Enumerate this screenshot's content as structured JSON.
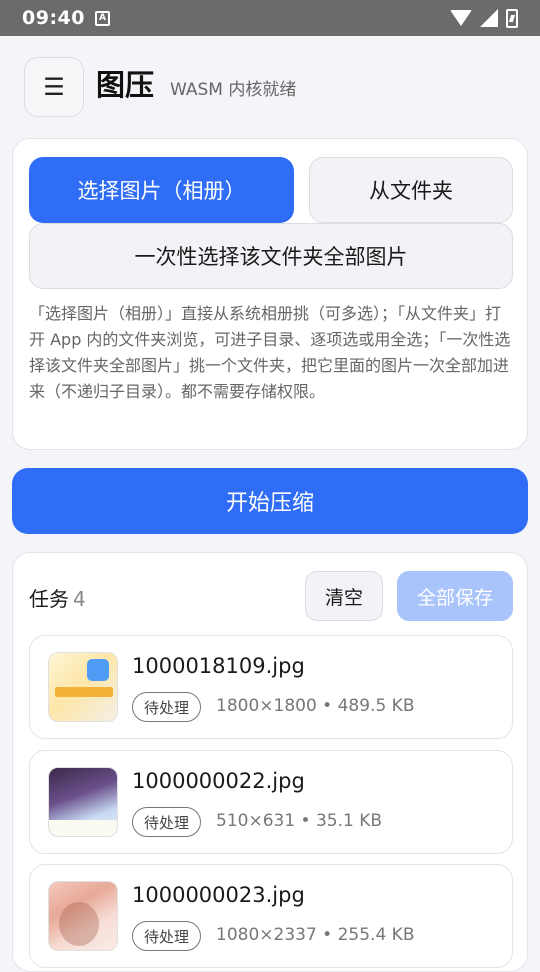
{
  "status_bar": {
    "time": "09:40",
    "notif_badge": "A"
  },
  "header": {
    "title": "图压",
    "subtitle": "WASM 内核就绪",
    "menu_icon": "☰"
  },
  "picker": {
    "album_label": "选择图片（相册）",
    "folder_label": "从文件夹",
    "folder_all_label": "一次性选择该文件夹全部图片",
    "help_text": "「选择图片（相册）」直接从系统相册挑（可多选）；「从文件夹」打开 App 内的文件夹浏览，可进子目录、逐项选或用全选；「一次性选择该文件夹全部图片」挑一个文件夹，把它里面的图片一次全部加进来（不递归子目录）。都不需要存储权限。"
  },
  "start_label": "开始压缩",
  "tasks": {
    "label": "任务",
    "count": "4",
    "clear_label": "清空",
    "save_all_label": "全部保存",
    "items": [
      {
        "name": "1000018109.jpg",
        "status": "待处理",
        "meta": "1800×1800 • 489.5 KB"
      },
      {
        "name": "1000000022.jpg",
        "status": "待处理",
        "meta": "510×631 • 35.1 KB"
      },
      {
        "name": "1000000023.jpg",
        "status": "待处理",
        "meta": "1080×2337 • 255.4 KB"
      }
    ]
  },
  "colors": {
    "accent": "#2f6df6",
    "accent_disabled": "#a9c3fb",
    "statusbar": "#6b6b6b"
  }
}
